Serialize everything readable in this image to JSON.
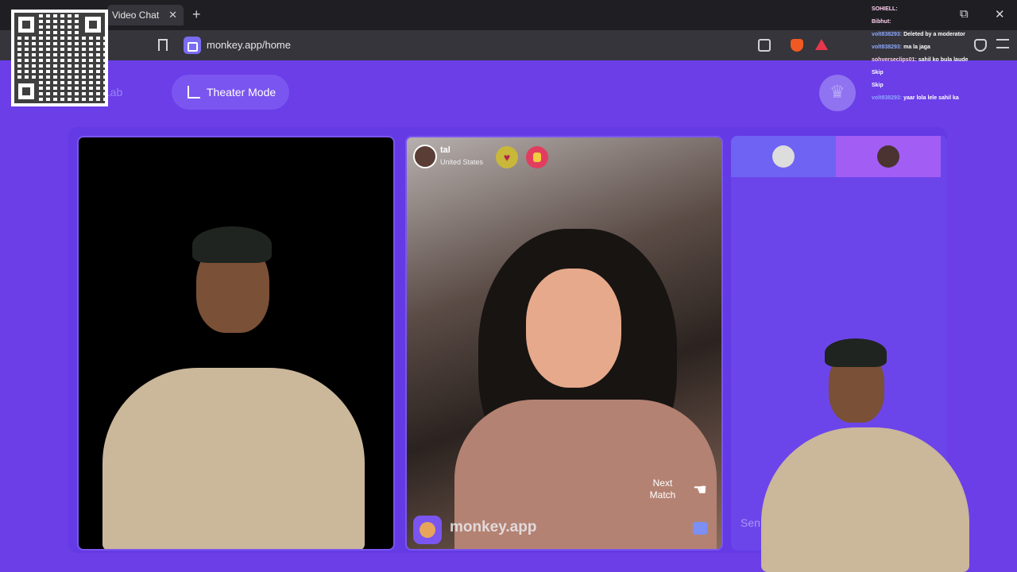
{
  "browser": {
    "tab_title": "Video Chat",
    "tab_close": "✕",
    "new_tab": "+",
    "url": "monkey.app/home",
    "window_restore": "⧉",
    "window_close": "✕"
  },
  "app": {
    "lab_label": "y Lab",
    "theater_mode_label": "Theater Mode"
  },
  "stranger": {
    "name": "tal",
    "country": "United States",
    "heart": "♥"
  },
  "video_controls": {
    "next_match_line1": "Next",
    "next_match_line2": "Match"
  },
  "watermark": {
    "text": "monkey.app"
  },
  "chat": {
    "input_placeholder": "Sen"
  },
  "stream_chat": [
    {
      "user": "SOHIELL:",
      "message": ""
    },
    {
      "user": "Bibhut:",
      "message": ""
    },
    {
      "user": "volt838293:",
      "message": "Deleted by a moderator"
    },
    {
      "user": "volt838293:",
      "message": "ma  la jaga"
    },
    {
      "user": "sohverseclips01:",
      "message": "sahil ko bula laude"
    },
    {
      "user": "",
      "message": "Skip"
    },
    {
      "user": "",
      "message": "Skip"
    },
    {
      "user": "volt838293:",
      "message": "yaar lola lele sahil ka"
    }
  ],
  "colors": {
    "app_bg": "#6b3ee8",
    "accent": "#7b55ef",
    "browser_chrome": "#35353b"
  }
}
